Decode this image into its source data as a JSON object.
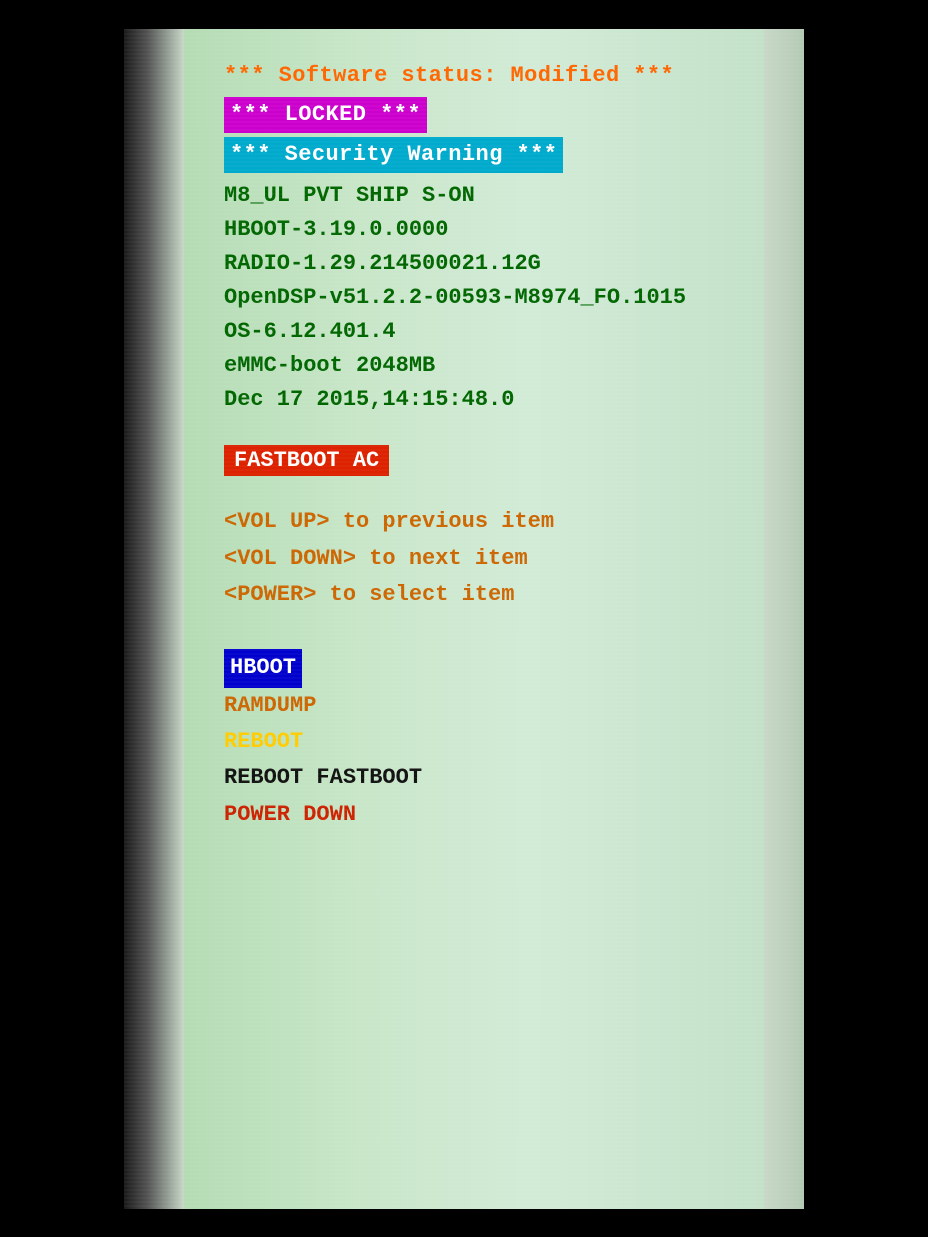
{
  "screen": {
    "software_status": "*** Software status: Modified ***",
    "locked": "*** LOCKED ***",
    "security_warning": "*** Security Warning ***",
    "info_lines": [
      "M8_UL PVT SHIP S-ON",
      "HBOOT-3.19.0.0000",
      "RADIO-1.29.214500021.12G",
      "OpenDSP-v51.2.2-00593-M8974_FO.1015",
      "OS-6.12.401.4",
      "eMMC-boot 2048MB",
      "Dec 17 2015,14:15:48.0"
    ],
    "fastboot_label": "FASTBOOT AC",
    "nav_items": [
      "<VOL UP> to previous item",
      "<VOL DOWN> to next item",
      "<POWER> to select item"
    ],
    "menu_items": {
      "hboot": "HBOOT",
      "ramdump": "RAMDUMP",
      "reboot": "REBOOT",
      "reboot_fastboot": "REBOOT FASTBOOT",
      "power_down": "POWER DOWN"
    }
  }
}
